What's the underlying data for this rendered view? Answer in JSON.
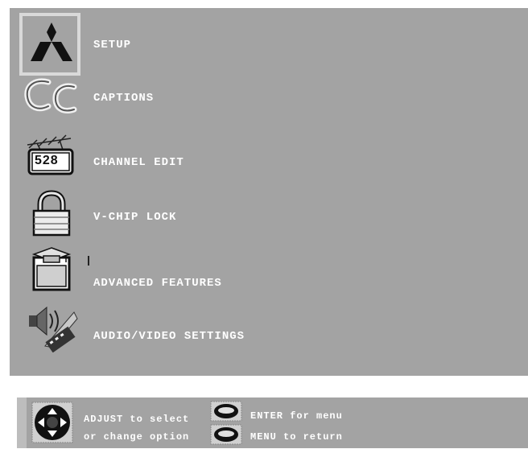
{
  "menu": {
    "items": [
      {
        "label": "SETUP",
        "icon": "mitsubishi-logo-icon",
        "selected": true
      },
      {
        "label": "CAPTIONS",
        "icon": "cc-captions-icon"
      },
      {
        "label": "CHANNEL EDIT",
        "icon": "channel-528-icon"
      },
      {
        "label": "V-CHIP LOCK",
        "icon": "padlock-icon"
      },
      {
        "label": "ADVANCED FEATURES",
        "icon": "graduation-cap-box-icon"
      },
      {
        "label": "AUDIO/VIDEO SETTINGS",
        "icon": "speaker-film-icon"
      }
    ],
    "channel_icon_text": "528"
  },
  "help": {
    "adjust_line1": "ADJUST to select",
    "adjust_line2": "or change option",
    "enter_text": "ENTER for menu",
    "menu_text": "MENU  to return"
  },
  "colors": {
    "panel": "#a3a3a3",
    "label": "#ffffff",
    "selection_frame": "#d9d9d9"
  }
}
